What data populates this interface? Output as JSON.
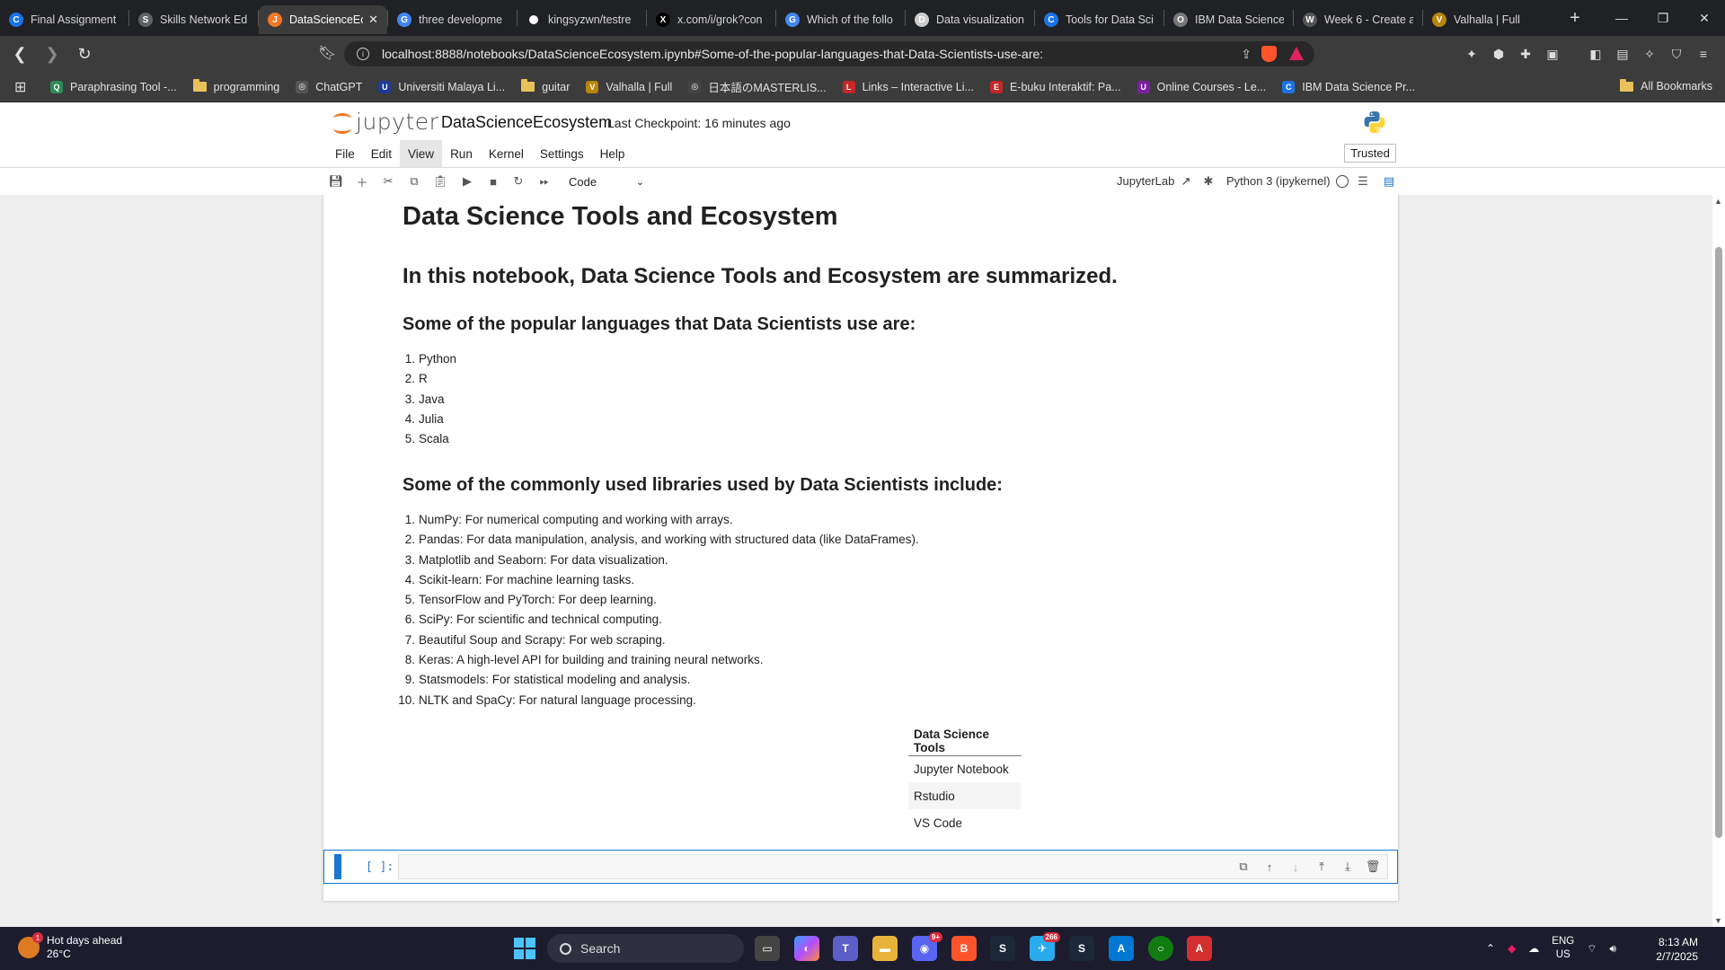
{
  "browser": {
    "tabs": [
      {
        "title": "Final Assignment",
        "color": "#1a73e8",
        "glyph": "C",
        "active": false
      },
      {
        "title": "Skills Network Ed",
        "color": "#5f6368",
        "glyph": "S",
        "active": false
      },
      {
        "title": "DataScienceEco",
        "color": "#f37726",
        "glyph": "J",
        "active": true
      },
      {
        "title": "three developme",
        "color": "#4285f4",
        "glyph": "G",
        "active": false
      },
      {
        "title": "kingsyzwn/testre",
        "color": "#ffffff",
        "glyph": "",
        "active": false
      },
      {
        "title": "x.com/i/grok?con",
        "color": "#000000",
        "glyph": "X",
        "active": false
      },
      {
        "title": "Which of the follo",
        "color": "#4285f4",
        "glyph": "G",
        "active": false
      },
      {
        "title": "Data visualization",
        "color": "#cccccc",
        "glyph": "D",
        "active": false
      },
      {
        "title": "Tools for Data Sci",
        "color": "#1a73e8",
        "glyph": "C",
        "active": false
      },
      {
        "title": "IBM Data Science",
        "color": "#777777",
        "glyph": "O",
        "active": false
      },
      {
        "title": "Week 6 - Create a",
        "color": "#555555",
        "glyph": "W",
        "active": false
      },
      {
        "title": "Valhalla | Full",
        "color": "#b8860b",
        "glyph": "V",
        "active": false
      }
    ],
    "url": "localhost:8888/notebooks/DataScienceEcosystem.ipynb#Some-of-the-popular-languages-that-Data-Scientists-use-are:",
    "bookmarks": [
      {
        "label": "Paraphrasing Tool -...",
        "type": "site",
        "color": "#2e8b57",
        "glyph": "Q"
      },
      {
        "label": "programming",
        "type": "folder"
      },
      {
        "label": "ChatGPT",
        "type": "site",
        "color": "#555555",
        "glyph": "◎"
      },
      {
        "label": "Universiti Malaya Li...",
        "type": "site",
        "color": "#1f3a93",
        "glyph": "U"
      },
      {
        "label": "guitar",
        "type": "folder"
      },
      {
        "label": "Valhalla | Full",
        "type": "site",
        "color": "#b8860b",
        "glyph": "V"
      },
      {
        "label": "日本語のMASTERLIS...",
        "type": "site",
        "color": "#444444",
        "glyph": "◎"
      },
      {
        "label": "Links – Interactive Li...",
        "type": "site",
        "color": "#c62828",
        "glyph": "L"
      },
      {
        "label": "E-buku Interaktif: Pa...",
        "type": "site",
        "color": "#c62828",
        "glyph": "E"
      },
      {
        "label": "Online Courses - Le...",
        "type": "site",
        "color": "#7b1fa2",
        "glyph": "U"
      },
      {
        "label": "IBM Data Science Pr...",
        "type": "site",
        "color": "#1a73e8",
        "glyph": "C"
      }
    ],
    "all_bookmarks": "All Bookmarks"
  },
  "jupyter": {
    "logo_text": "jupyter",
    "notebook_name": "DataScienceEcosystem",
    "checkpoint": "Last Checkpoint: 16 minutes ago",
    "menus": [
      "File",
      "Edit",
      "View",
      "Run",
      "Kernel",
      "Settings",
      "Help"
    ],
    "active_menu": "View",
    "trusted": "Trusted",
    "cell_type": "Code",
    "jupyterlab_link": "JupyterLab",
    "kernel": "Python 3 (ipykernel)"
  },
  "notebook": {
    "h1": "Data Science Tools and Ecosystem",
    "h2": "In this notebook, Data Science Tools and Ecosystem are summarized.",
    "languages_heading": "Some of the popular languages that Data Scientists use are:",
    "languages": [
      "Python",
      "R",
      "Java",
      "Julia",
      "Scala"
    ],
    "libraries_heading": "Some of the commonly used libraries used by Data Scientists include:",
    "libraries": [
      "NumPy: For numerical computing and working with arrays.",
      "Pandas: For data manipulation, analysis, and working with structured data (like DataFrames).",
      "Matplotlib and Seaborn: For data visualization.",
      "Scikit-learn: For machine learning tasks.",
      "TensorFlow and PyTorch: For deep learning.",
      "SciPy: For scientific and technical computing.",
      "Beautiful Soup and Scrapy: For web scraping.",
      "Keras: A high-level API for building and training neural networks.",
      "Statsmodels: For statistical modeling and analysis.",
      "NLTK and SpaCy: For natural language processing."
    ],
    "tools_table": {
      "header": "Data Science Tools",
      "rows": [
        "Jupyter Notebook",
        "Rstudio",
        "VS Code"
      ]
    },
    "empty_cell_prompt": "[ ]:"
  },
  "taskbar": {
    "weather_title": "Hot days ahead",
    "weather_temp": "26°C",
    "search_placeholder": "Search",
    "discord_badge": "9+",
    "chat_badge": "266",
    "lang_line1": "ENG",
    "lang_line2": "US",
    "time": "8:13 AM",
    "date": "2/7/2025"
  }
}
